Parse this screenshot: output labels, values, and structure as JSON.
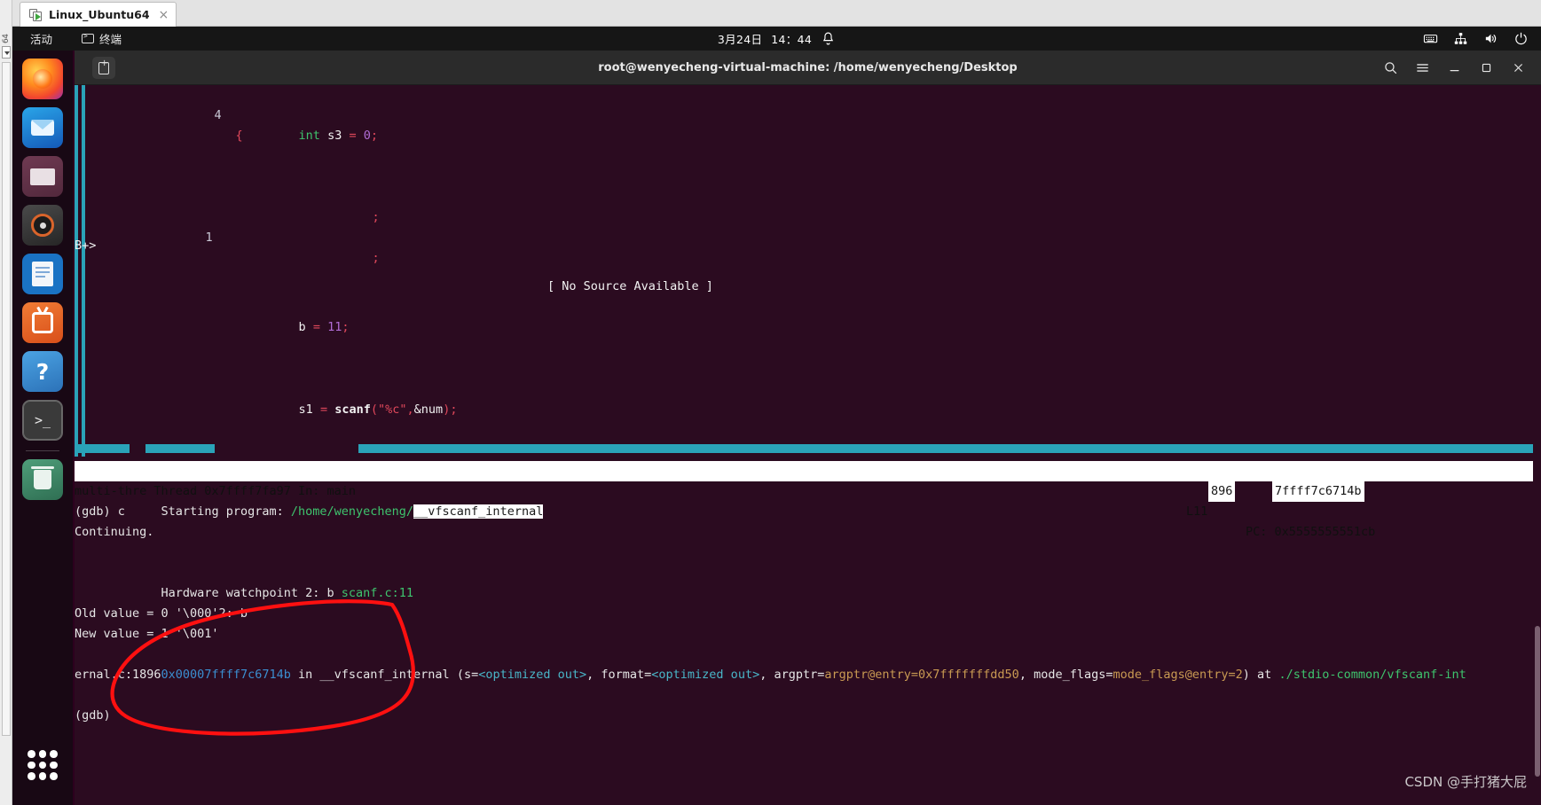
{
  "vmware": {
    "tab_label": "Linux_Ubuntu64",
    "tab_close": "×",
    "edge_label": "64"
  },
  "gnome_topbar": {
    "activities": "活动",
    "app_name": "终端",
    "date": "3月24日",
    "time": "14：44",
    "tray_icons": [
      "keyboard-icon",
      "network-icon",
      "volume-icon",
      "power-icon"
    ]
  },
  "dock": {
    "items": [
      {
        "name": "firefox",
        "label": "Firefox"
      },
      {
        "name": "thunderbird",
        "label": "Thunderbird Mail"
      },
      {
        "name": "files",
        "label": "Files"
      },
      {
        "name": "rhythmbox",
        "label": "Rhythmbox"
      },
      {
        "name": "libreoffice-writer",
        "label": "LibreOffice Writer"
      },
      {
        "name": "ubuntu-software",
        "label": "Ubuntu Software"
      },
      {
        "name": "help",
        "label": "Help"
      },
      {
        "name": "terminal",
        "label": "Terminal"
      },
      {
        "name": "trash",
        "label": "Trash"
      }
    ],
    "show_apps_label": "Show Applications"
  },
  "terminal": {
    "title": "root@wenyecheng-virtual-machine: /home/wenyecheng/Desktop",
    "new_tab_label": "New Tab",
    "buttons": [
      "search-icon",
      "menu-icon",
      "minimize-icon",
      "maximize-icon",
      "close-icon"
    ]
  },
  "tui_source": {
    "lines": [
      {
        "no": "4",
        "code": "{"
      },
      {
        "no": "",
        "code": "int s3 = 0;"
      },
      {
        "no": "",
        "code": ";"
      },
      {
        "no": "1",
        "code": ";"
      }
    ],
    "breakpoint_marker": "B+>",
    "no_source": "[ No Source Available ]",
    "line_b": "b = 11;",
    "line_scanf": "s1 = scanf(\"%c\",&num);",
    "tokens": {
      "brace": "{",
      "kw_int": "int",
      "var_s3": "s3",
      "eq": "=",
      "zero": "0",
      "semi": ";",
      "var_b": "b",
      "num_11": "11",
      "var_s1": "s1",
      "fn_scanf": "scanf",
      "paren_open": "(",
      "str_fmt": "\"%c\"",
      "comma": ",",
      "amp_num": "&num",
      "paren_close": ")"
    }
  },
  "tui_status": {
    "left": "multi-thre Thread 0x7ffff7fa97 In: main",
    "line_label": "L11",
    "pc_label": "PC: 0x5555555551cb"
  },
  "gdb_output": {
    "lines": [
      "Starting program: /home/wenyecheng/__vfscanf_internal",
      "(gdb) c",
      "Continuing.",
      "",
      "Hardware watchpoint 2: b scanf.c:11",
      "",
      "Old value = 0 '\\000'2: b",
      "New value = 1 '\\001'",
      "0x00007ffff7c6714b in __vfscanf_internal (s=<optimized out>, format=<optimized out>, argptr=argptr@entry=0x7fffffffdd50, mode_flags=mode_flags@entry=2) at ./stdio-common/vfscanf-int",
      "ernal.c:1896",
      "(gdb)"
    ],
    "start_prefix": "Starting program: ",
    "start_path": "/home/wenyecheng/",
    "start_highlight": "__vfscanf_internal",
    "side_badge_1": "896",
    "side_badge_2": "7ffff7c6714b",
    "cmd_c": "(gdb) c",
    "continuing": "Continuing.",
    "watchpoint_prefix": "Hardware watchpoint 2: b ",
    "watchpoint_file": "scanf.c:11",
    "old_value": "Old value = 0 '\\000'2: b",
    "new_value": "New value = 1 '\\001'",
    "frame_addr": "0x00007ffff7c6714b",
    "frame_in": " in ",
    "frame_fn": "__vfscanf_internal",
    "frame_args_a": " (s=",
    "frame_opt1": "<optimized out>",
    "frame_args_b": ", format=",
    "frame_opt2": "<optimized out>",
    "frame_args_c": ", argptr=",
    "frame_argptr": "argptr@entry=0x7fffffffdd50",
    "frame_args_d": ", mode_flags=",
    "frame_modeflags": "mode_flags@entry=2",
    "frame_at": ") at ",
    "frame_file": "./stdio-common/vfscanf-int",
    "frame_file2": "ernal.c:1896",
    "prompt": "(gdb)"
  },
  "watermark": "CSDN @手打猪大屁",
  "colors": {
    "terminal_bg": "#2b0b20",
    "tui_border": "#2aa3b8",
    "annotation": "#ff1010",
    "green": "#3ec46d",
    "red": "#e0485b",
    "purple": "#b06cd6",
    "blue": "#3b8ed0"
  }
}
